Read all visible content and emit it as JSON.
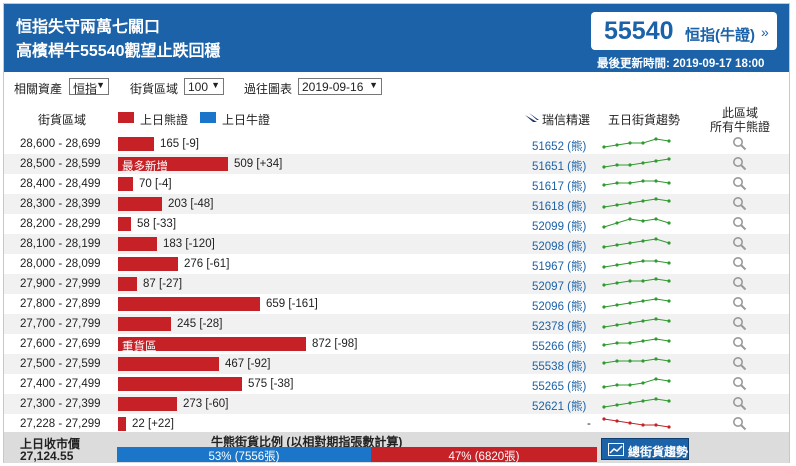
{
  "header": {
    "title_line1": "恒指失守兩萬七關口",
    "title_line2": "高檳桿牛55540觀望止跌回穩",
    "quote_value": "55540",
    "quote_index": "恒指(牛證)",
    "quote_arrow": "»",
    "updated": "最後更新時間: 2019-09-17 18:00"
  },
  "filters": {
    "asset_label": "相關資產",
    "asset_value": "恒指",
    "zone_label": "街貨區域",
    "zone_value": "100",
    "chart_label": "過往圖表",
    "chart_value": "2019-09-16"
  },
  "columns": {
    "zone": "街貨區域",
    "bear_legend": "上日熊證",
    "bull_legend": "上日牛證",
    "picks": "瑞信精選",
    "trend": "五日街貨趨勢",
    "all_bull_1": "此區域",
    "all_bull_2": "所有牛熊證"
  },
  "colors": {
    "bear": "#c62127",
    "bull": "#1b76c9",
    "header": "#1b62a8"
  },
  "rows": [
    {
      "range": "28,600 - 28,699",
      "value": 165,
      "change": "[-9]",
      "code": "51652 (熊)",
      "trend": [
        2,
        3,
        4,
        4,
        6,
        5
      ],
      "tag": ""
    },
    {
      "range": "28,500 - 28,599",
      "value": 509,
      "change": "[+34]",
      "code": "51651 (熊)",
      "trend": [
        2,
        3,
        3,
        4,
        5,
        6
      ],
      "tag": "最多新增"
    },
    {
      "range": "28,400 - 28,499",
      "value": 70,
      "change": "[-4]",
      "code": "51617 (熊)",
      "trend": [
        3,
        4,
        4,
        5,
        5,
        4
      ],
      "tag": ""
    },
    {
      "range": "28,300 - 28,399",
      "value": 203,
      "change": "[-48]",
      "code": "51618 (熊)",
      "trend": [
        2,
        3,
        4,
        5,
        6,
        5
      ],
      "tag": ""
    },
    {
      "range": "28,200 - 28,299",
      "value": 58,
      "change": "[-33]",
      "code": "52099 (熊)",
      "trend": [
        2,
        4,
        6,
        5,
        6,
        4
      ],
      "tag": ""
    },
    {
      "range": "28,100 - 28,199",
      "value": 183,
      "change": "[-120]",
      "code": "52098 (熊)",
      "trend": [
        2,
        3,
        4,
        5,
        6,
        4
      ],
      "tag": ""
    },
    {
      "range": "28,000 - 28,099",
      "value": 276,
      "change": "[-61]",
      "code": "51967 (熊)",
      "trend": [
        2,
        3,
        4,
        5,
        5,
        4
      ],
      "tag": ""
    },
    {
      "range": "27,900 - 27,999",
      "value": 87,
      "change": "[-27]",
      "code": "52097 (熊)",
      "trend": [
        3,
        4,
        5,
        5,
        6,
        5
      ],
      "tag": ""
    },
    {
      "range": "27,800 - 27,899",
      "value": 659,
      "change": "[-161]",
      "code": "52096 (熊)",
      "trend": [
        2,
        3,
        4,
        5,
        6,
        5
      ],
      "tag": ""
    },
    {
      "range": "27,700 - 27,799",
      "value": 245,
      "change": "[-28]",
      "code": "52378 (熊)",
      "trend": [
        2,
        3,
        4,
        5,
        6,
        5
      ],
      "tag": ""
    },
    {
      "range": "27,600 - 27,699",
      "value": 872,
      "change": "[-98]",
      "code": "55266 (熊)",
      "trend": [
        3,
        4,
        4,
        5,
        6,
        5
      ],
      "tag": "重貨區"
    },
    {
      "range": "27,500 - 27,599",
      "value": 467,
      "change": "[-92]",
      "code": "55538 (熊)",
      "trend": [
        4,
        5,
        5,
        5,
        6,
        5
      ],
      "tag": ""
    },
    {
      "range": "27,400 - 27,499",
      "value": 575,
      "change": "[-38]",
      "code": "55265 (熊)",
      "trend": [
        2,
        3,
        3,
        4,
        6,
        5
      ],
      "tag": ""
    },
    {
      "range": "27,300 - 27,399",
      "value": 273,
      "change": "[-60]",
      "code": "52621 (熊)",
      "trend": [
        2,
        3,
        4,
        5,
        6,
        5
      ],
      "tag": ""
    },
    {
      "range": "27,228 - 27,299",
      "value": 22,
      "change": "[+22]",
      "code": "-",
      "trend": [
        6,
        5,
        4,
        3,
        3,
        2
      ],
      "tag": "",
      "trend_color": "#c62127"
    }
  ],
  "footer": {
    "close_label": "上日收市價",
    "close_value": "27,124.55",
    "ratio_title": "牛熊街貨比例 (以相對期指張數計算)",
    "bull_text": "53% (7556張)",
    "bear_text": "47% (6820張)",
    "bull_share": 53,
    "trend_button": "總街貨趨勢"
  }
}
